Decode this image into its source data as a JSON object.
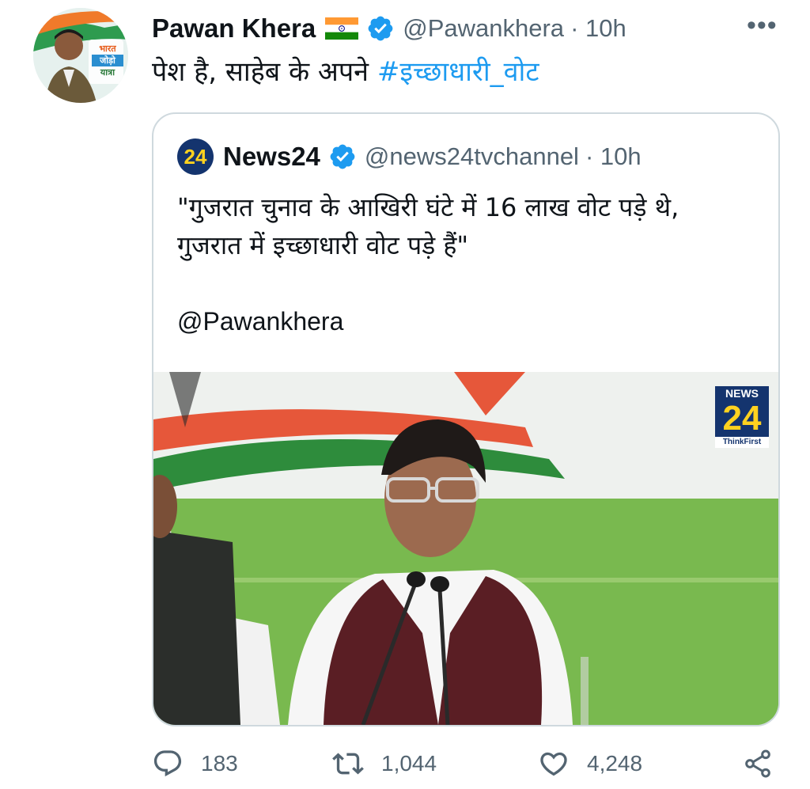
{
  "tweet": {
    "author_name": "Pawan Khera",
    "handle": "@Pawankhera",
    "time": "· 10h",
    "more_label": "•••",
    "text_prefix": "पेश है, साहेब के अपने ",
    "hashtag": "#इच्छाधारी_वोट",
    "avatar_badge_text": [
      "भारत",
      "जोड़ो",
      "यात्रा"
    ]
  },
  "quoted": {
    "author_name": "News24",
    "handle": "@news24tvchannel",
    "time": "· 10h",
    "logo_text": "24",
    "text_line1": "\"गुजरात चुनाव के आखिरी घंटे में 16 लाख वोट पड़े थे,",
    "text_line2": "गुजरात में इच्छाधारी वोट पड़े हैं\"",
    "mention": "@Pawankhera",
    "media_watermark": {
      "top": "NEWS",
      "number": "24",
      "tagline": "ThinkFirst"
    }
  },
  "actions": {
    "replies": "183",
    "retweets": "1,044",
    "likes": "4,248"
  },
  "colors": {
    "accent": "#1d9bf0",
    "muted": "#536471",
    "border": "#cfd9de"
  },
  "icons": [
    "flag-india-icon",
    "verified-icon",
    "more-icon",
    "reply-icon",
    "retweet-icon",
    "like-icon",
    "share-icon"
  ]
}
